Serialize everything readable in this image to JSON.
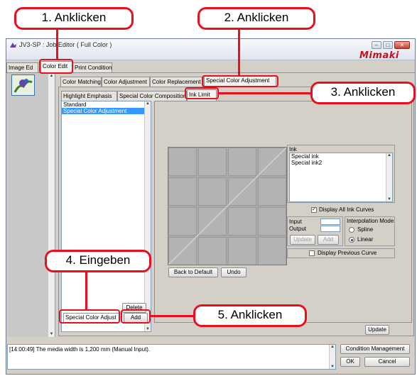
{
  "window": {
    "title": "JV3-SP : Job Editor ( Full Color )",
    "logo": "Mimaki",
    "controls": {
      "minimize": "–",
      "maximize": "□",
      "close": "✕"
    }
  },
  "main_tabs": [
    "Image Ed",
    "Color Edit",
    "Print Condition"
  ],
  "sub_tabs": [
    "Color Matching",
    "Color Adjustment",
    "Color Replacement",
    "Special Color Adjustment"
  ],
  "inner_tabs": [
    "Highlight Emphasis",
    "Special Color Composition",
    "Ink Limit"
  ],
  "preset_list": {
    "items": [
      "Standard",
      "Special Color Adjustment"
    ],
    "selected_index": 1
  },
  "preset_actions": {
    "delete": "Delete",
    "name_input_value": "Special Color Adjust",
    "add": "Add"
  },
  "ink": {
    "label": "Ink",
    "items": [
      "Special ink",
      "Special ink2"
    ],
    "display_all_label": "Display All Ink Curves",
    "display_all_checked": true
  },
  "curve_controls": {
    "input_label": "Input",
    "output_label": "Output",
    "update": "Update",
    "add": "Add",
    "interp_label": "Interpolation Mode",
    "spline": "Spline",
    "linear": "Linear",
    "selected_mode": "Linear",
    "previous_label": "Display Previous Curve",
    "previous_checked": false
  },
  "graph_buttons": {
    "back": "Back to Default",
    "undo": "Undo"
  },
  "update_button": "Update",
  "log_text": "[14:00:49] The media width is 1,200 mm (Manual Input).",
  "footer_buttons": {
    "condition": "Condition Management",
    "ok": "OK",
    "cancel": "Cancel"
  },
  "callouts": {
    "step1": "1. Anklicken",
    "step2": "2. Anklicken",
    "step3": "3. Anklicken",
    "step4": "4. Eingeben",
    "step5": "5. Anklicken"
  },
  "colors": {
    "callout": "#e8101e",
    "selection": "#3399ff",
    "logo": "#c80f1e"
  }
}
